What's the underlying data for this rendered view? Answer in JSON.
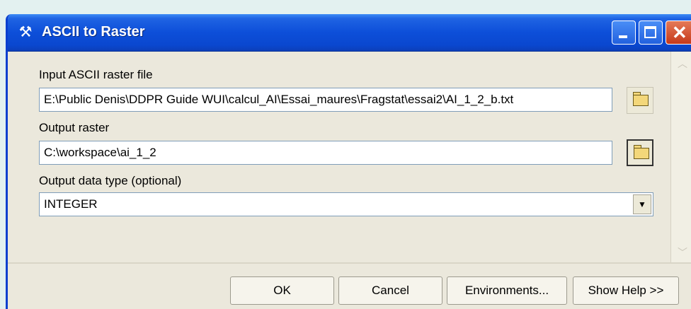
{
  "window": {
    "title": "ASCII to Raster",
    "title_icon": "hammer-icon"
  },
  "fields": {
    "input_label": "Input ASCII raster file",
    "input_value": "E:\\Public Denis\\DDPR Guide WUI\\calcul_AI\\Essai_maures\\Fragstat\\essai2\\AI_1_2_b.txt",
    "output_label": "Output raster",
    "output_value": "C:\\workspace\\ai_1_2",
    "datatype_label": "Output data type (optional)",
    "datatype_value": "INTEGER"
  },
  "buttons": {
    "ok": "OK",
    "cancel": "Cancel",
    "environments": "Environments...",
    "show_help": "Show Help >>"
  },
  "colors": {
    "titlebar": "#0d4fd9",
    "dialog_bg": "#ece9d8",
    "close_button": "#c6391a"
  }
}
